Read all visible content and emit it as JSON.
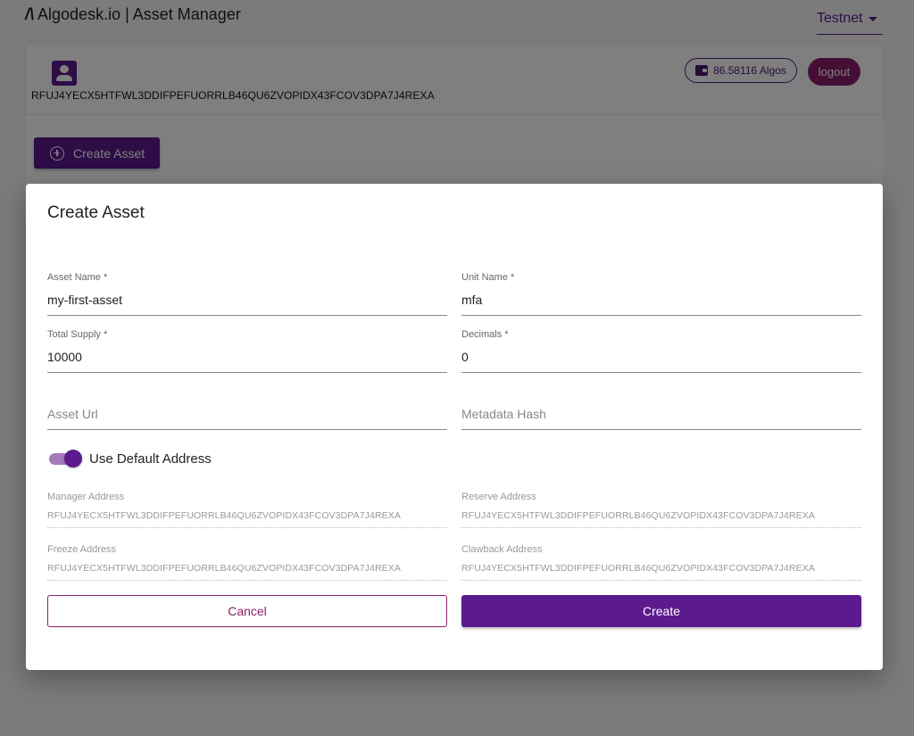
{
  "appbar": {
    "brand_mark": "/\\",
    "title": "Algodesk.io | Asset Manager",
    "network": "Testnet"
  },
  "account": {
    "address": "RFUJ4YECX5HTFWL3DDIFPEFUORRLB46QU6ZVOPIDX43FCOV3DPA7J4REXA",
    "balance": "86.58116 Algos",
    "logout_label": "logout"
  },
  "main": {
    "create_asset_label": "Create Asset"
  },
  "dialog": {
    "title": "Create Asset",
    "asset_name": {
      "label": "Asset Name *",
      "value": "my-first-asset"
    },
    "unit_name": {
      "label": "Unit Name *",
      "value": "mfa"
    },
    "total_supply": {
      "label": "Total Supply *",
      "value": "10000"
    },
    "decimals": {
      "label": "Decimals *",
      "value": "0"
    },
    "asset_url": {
      "placeholder": "Asset Url"
    },
    "metadata_hash": {
      "placeholder": "Metadata Hash"
    },
    "use_default_address": {
      "label": "Use Default Address",
      "checked": true
    },
    "manager_address": {
      "label": "Manager Address",
      "value": "RFUJ4YECX5HTFWL3DDIFPEFUORRLB46QU6ZVOPIDX43FCOV3DPA7J4REXA"
    },
    "reserve_address": {
      "label": "Reserve Address",
      "value": "RFUJ4YECX5HTFWL3DDIFPEFUORRLB46QU6ZVOPIDX43FCOV3DPA7J4REXA"
    },
    "freeze_address": {
      "label": "Freeze Address",
      "value": "RFUJ4YECX5HTFWL3DDIFPEFUORRLB46QU6ZVOPIDX43FCOV3DPA7J4REXA"
    },
    "clawback_address": {
      "label": "Clawback Address",
      "value": "RFUJ4YECX5HTFWL3DDIFPEFUORRLB46QU6ZVOPIDX43FCOV3DPA7J4REXA"
    },
    "cancel_label": "Cancel",
    "create_label": "Create"
  },
  "colors": {
    "primary": "#5c1a8f",
    "secondary": "#8a1f6b",
    "overlay": "rgba(0,0,0,0.5)"
  }
}
